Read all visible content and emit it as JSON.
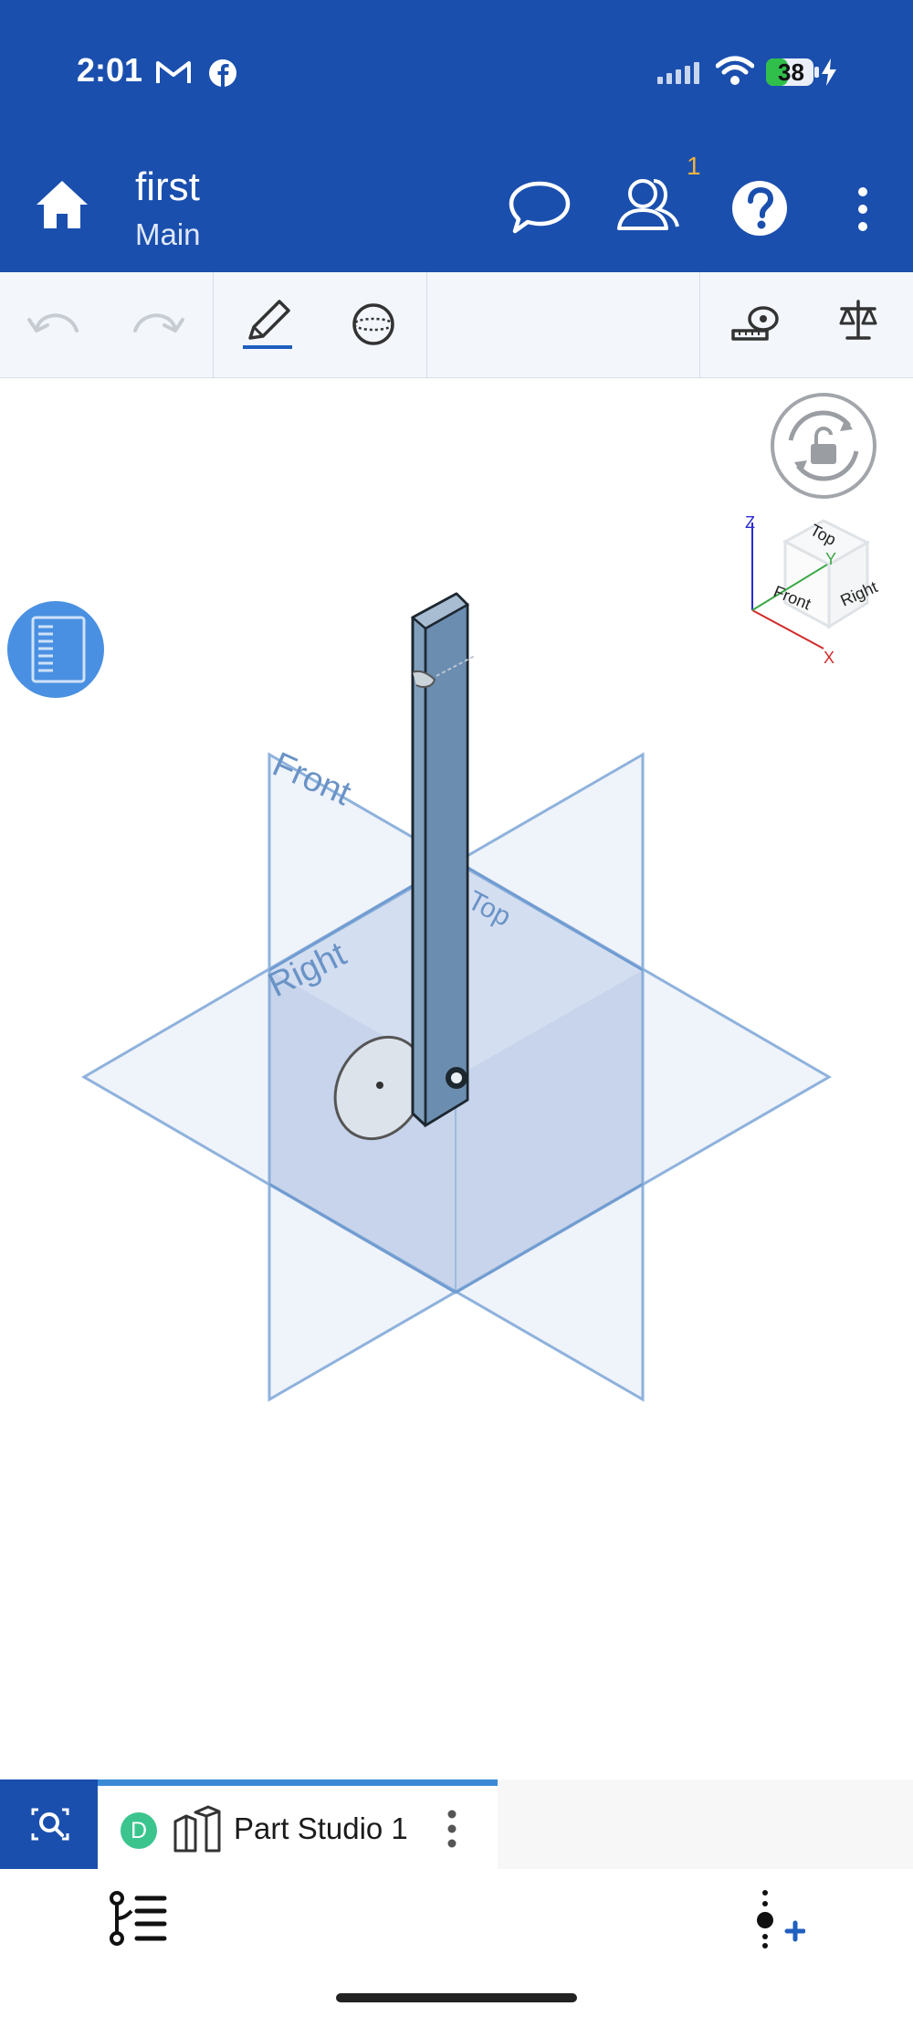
{
  "status_bar": {
    "time": "2:01",
    "battery": "38",
    "icons": [
      "gmail-icon",
      "facebook-icon",
      "signal-icon",
      "wifi-icon",
      "battery-icon",
      "charging-icon"
    ]
  },
  "header": {
    "title": "first",
    "subtitle": "Main",
    "collaborator_count": "1",
    "icons": [
      "home-icon",
      "comment-icon",
      "users-icon",
      "help-icon",
      "more-vertical-icon"
    ]
  },
  "toolbar": {
    "icons": [
      "undo-icon",
      "redo-icon",
      "sketch-pencil-icon",
      "sphere-icon",
      "measure-tape-icon",
      "mass-properties-icon"
    ]
  },
  "viewcube": {
    "faces": {
      "top": "Top",
      "front": "Front",
      "right": "Right"
    },
    "axes": {
      "x": "X",
      "y": "Y",
      "z": "Z"
    },
    "colors": {
      "x": "#d12a2a",
      "y": "#3aa845",
      "z": "#2a2ad1"
    }
  },
  "planes": {
    "front": "Front",
    "right": "Right",
    "top": "Top"
  },
  "bottom_tabs": {
    "active_tab": {
      "badge": "D",
      "label": "Part Studio 1"
    },
    "icons": [
      "search-icon",
      "part-studio-icon",
      "more-vertical-icon"
    ]
  },
  "bottom_bar": {
    "icons": [
      "feature-tree-icon",
      "insert-feature-icon"
    ]
  },
  "colors": {
    "brand_blue": "#1a4fae",
    "plane_blue": "#6b98cc",
    "accent_tab": "#3c8ad6",
    "badge_green": "#3bc48e"
  }
}
